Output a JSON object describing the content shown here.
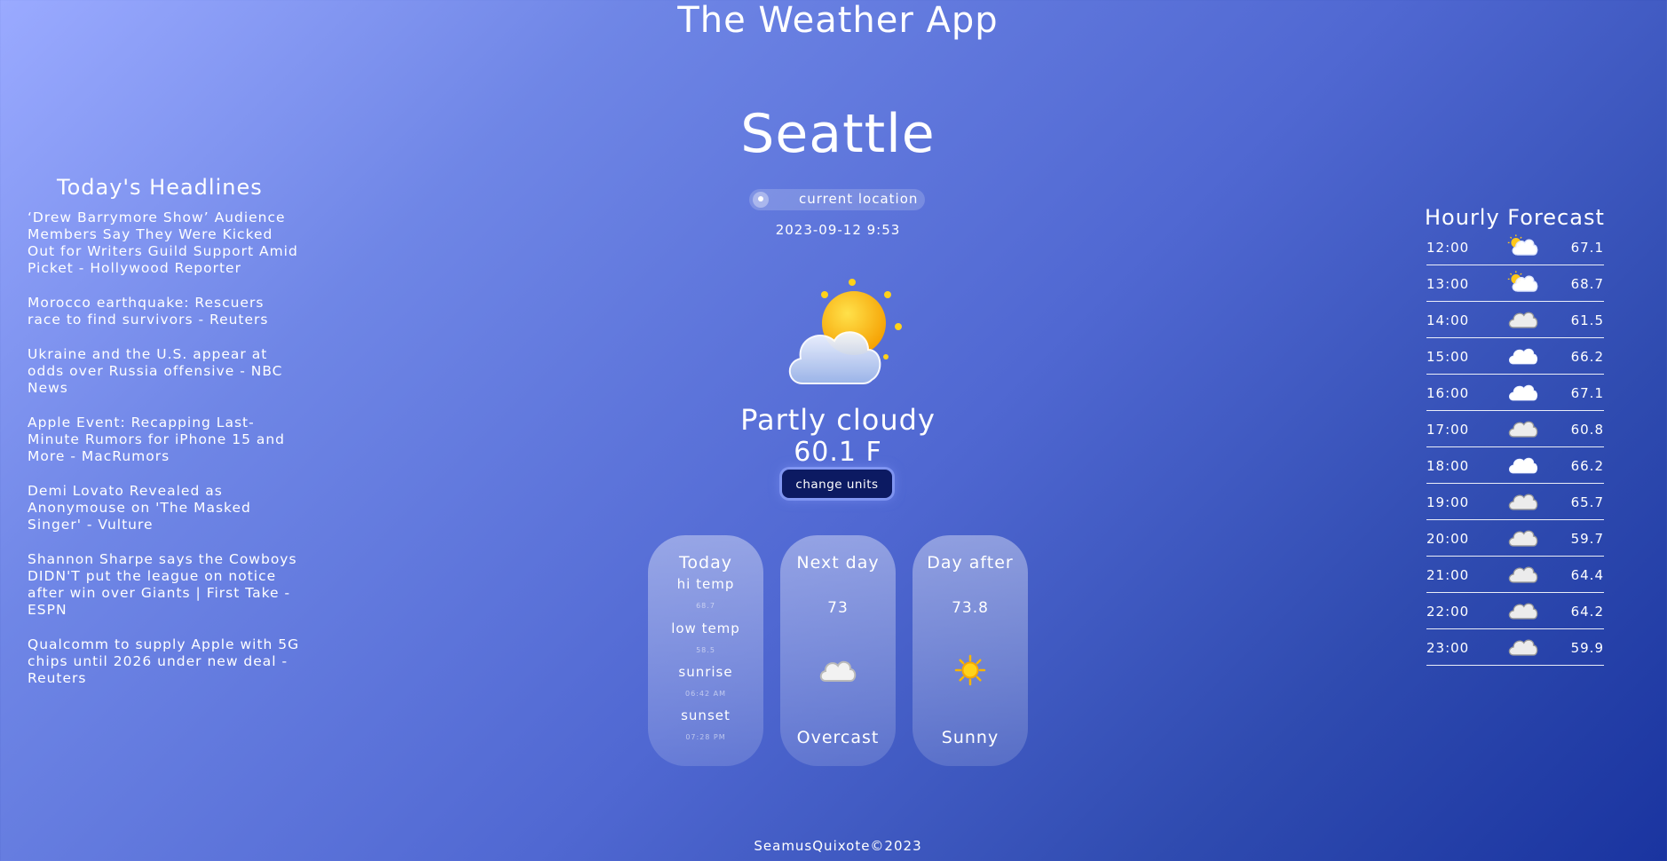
{
  "app_title": "The Weather App",
  "city": "Seattle",
  "location_button": {
    "label": "current location"
  },
  "datetime": "2023-09-12 9:53",
  "current": {
    "condition": "Partly cloudy",
    "temperature": "60.1 F",
    "icon": "partly-cloudy-icon"
  },
  "units_button": {
    "label": "change units"
  },
  "cards": {
    "today": {
      "title": "Today",
      "hi_label": "hi temp",
      "hi_value": "68.7",
      "low_label": "low temp",
      "low_value": "58.5",
      "sunrise_label": "sunrise",
      "sunrise_value": "06:42 AM",
      "sunset_label": "sunset",
      "sunset_value": "07:28 PM"
    },
    "next_day": {
      "title": "Next day",
      "temp": "73",
      "condition": "Overcast",
      "icon": "cloud-icon"
    },
    "day_after": {
      "title": "Day after",
      "temp": "73.8",
      "condition": "Sunny",
      "icon": "sun-icon"
    }
  },
  "headlines": {
    "title": "Today's Headlines",
    "items": [
      "‘Drew Barrymore Show’ Audience Members Say They Were Kicked Out for Writers Guild Support Amid Picket - Hollywood Reporter",
      "Morocco earthquake: Rescuers race to find survivors - Reuters",
      "Ukraine and the U.S. appear at odds over Russia offensive - NBC News",
      "Apple Event: Recapping Last-Minute Rumors for iPhone 15 and More - MacRumors",
      "Demi Lovato Revealed as Anonymouse on 'The Masked Singer' - Vulture",
      "Shannon Sharpe says the Cowboys DIDN'T put the league on notice after win over Giants | First Take - ESPN",
      "Qualcomm to supply Apple with 5G chips until 2026 under new deal - Reuters"
    ]
  },
  "hourly": {
    "title": "Hourly Forecast",
    "rows": [
      {
        "time": "12:00",
        "value": "67.1",
        "icon": "partly-cloudy-icon"
      },
      {
        "time": "13:00",
        "value": "68.7",
        "icon": "partly-cloudy-icon"
      },
      {
        "time": "14:00",
        "value": "61.5",
        "icon": "overcast-cloud-icon"
      },
      {
        "time": "15:00",
        "value": "66.2",
        "icon": "cloud-icon"
      },
      {
        "time": "16:00",
        "value": "67.1",
        "icon": "cloud-icon"
      },
      {
        "time": "17:00",
        "value": "60.8",
        "icon": "overcast-cloud-icon"
      },
      {
        "time": "18:00",
        "value": "66.2",
        "icon": "cloud-icon"
      },
      {
        "time": "19:00",
        "value": "65.7",
        "icon": "overcast-cloud-icon"
      },
      {
        "time": "20:00",
        "value": "59.7",
        "icon": "overcast-cloud-icon"
      },
      {
        "time": "21:00",
        "value": "64.4",
        "icon": "overcast-cloud-icon"
      },
      {
        "time": "22:00",
        "value": "64.2",
        "icon": "overcast-cloud-icon"
      },
      {
        "time": "23:00",
        "value": "59.9",
        "icon": "overcast-cloud-icon"
      }
    ]
  },
  "footer": "SeamusQuixote©2023",
  "colors": {
    "units_button_bg": "#0c1a62",
    "background_start": "#9aaaff",
    "background_end": "#1a34a0",
    "sun": "#f7b500"
  }
}
